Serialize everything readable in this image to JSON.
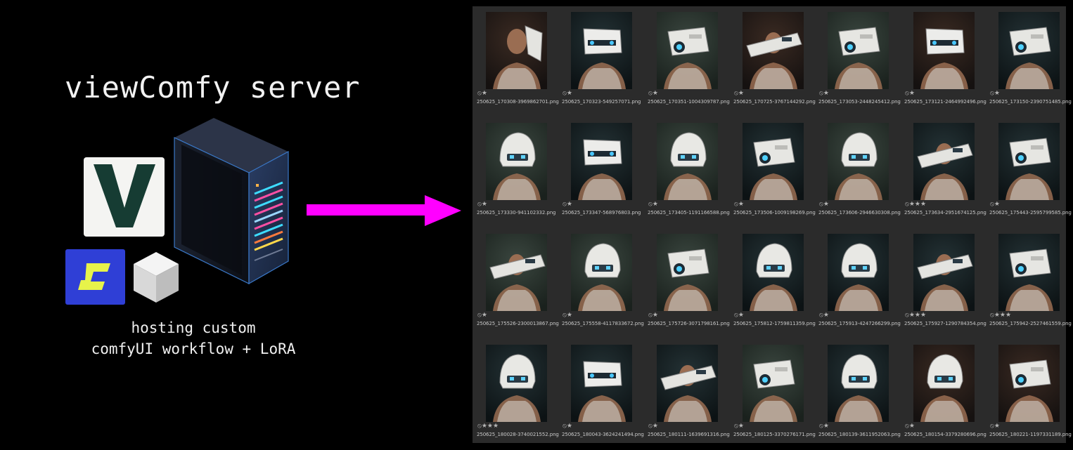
{
  "slide": {
    "title": "viewComfy server",
    "caption_line1": "hosting custom",
    "caption_line2": "comfyUI workflow + LoRA",
    "arrow_color": "#ff00ff",
    "icons": [
      "viewcomfy-logo",
      "comfy-logo",
      "cube-icon",
      "server-rack-icon",
      "arrow-right-icon"
    ]
  },
  "gallery": {
    "background": "#2b2b2b",
    "items": [
      {
        "file": "250625_170308-3969862701.png",
        "rating": "⦸★",
        "tone": "warm",
        "helmet": "side"
      },
      {
        "file": "250625_170323-549257071.png",
        "rating": "⦸★",
        "tone": "dark",
        "helmet": "visor"
      },
      {
        "file": "250625_170351-1004309787.png",
        "rating": "⦸★",
        "tone": "green",
        "helmet": "cam"
      },
      {
        "file": "250625_170725-3767144292.png",
        "rating": "⦸★",
        "tone": "warm",
        "helmet": "gun"
      },
      {
        "file": "250625_173053-2448245412.png",
        "rating": "⦸★",
        "tone": "green",
        "helmet": "cam"
      },
      {
        "file": "250625_173121-2464992496.png",
        "rating": "⦸★",
        "tone": "warm",
        "helmet": "visor"
      },
      {
        "file": "250625_173150-2390751485.png",
        "rating": "⦸★",
        "tone": "dark",
        "helmet": "cam"
      },
      {
        "file": "250625_173330-941102332.png",
        "rating": "⦸★",
        "tone": "green",
        "helmet": "dome"
      },
      {
        "file": "250625_173347-568976803.png",
        "rating": "⦸★",
        "tone": "dark",
        "helmet": "visor"
      },
      {
        "file": "250625_173405-1191166588.png",
        "rating": "⦸★",
        "tone": "green",
        "helmet": "dome"
      },
      {
        "file": "250625_173506-1009198269.png",
        "rating": "⦸★",
        "tone": "dark",
        "helmet": "cam"
      },
      {
        "file": "250625_173606-2946630308.png",
        "rating": "⦸★",
        "tone": "green",
        "helmet": "dome"
      },
      {
        "file": "250625_173634-2951674125.png",
        "rating": "⦸★★★",
        "tone": "dark",
        "helmet": "gun"
      },
      {
        "file": "250625_175443-2595799585.png",
        "rating": "⦸★",
        "tone": "dark",
        "helmet": "cam"
      },
      {
        "file": "250625_175526-2300013867.png",
        "rating": "⦸★",
        "tone": "green",
        "helmet": "gun"
      },
      {
        "file": "250625_175558-4117833672.png",
        "rating": "⦸★",
        "tone": "green",
        "helmet": "dome"
      },
      {
        "file": "250625_175726-3071798161.png",
        "rating": "⦸★",
        "tone": "green",
        "helmet": "cam"
      },
      {
        "file": "250625_175812-1759811359.png",
        "rating": "⦸★",
        "tone": "dark",
        "helmet": "dome"
      },
      {
        "file": "250625_175913-4247266299.png",
        "rating": "⦸★",
        "tone": "dark",
        "helmet": "dome"
      },
      {
        "file": "250625_175927-1290784354.png",
        "rating": "⦸★★★",
        "tone": "dark",
        "helmet": "gun"
      },
      {
        "file": "250625_175942-2527461559.png",
        "rating": "⦸★★★",
        "tone": "dark",
        "helmet": "cam"
      },
      {
        "file": "250625_180028-3740021552.png",
        "rating": "⦸★★★",
        "tone": "dark",
        "helmet": "dome"
      },
      {
        "file": "250625_180043-3624241494.png",
        "rating": "⦸★",
        "tone": "dark",
        "helmet": "visor"
      },
      {
        "file": "250625_180111-1639691316.png",
        "rating": "⦸★",
        "tone": "dark",
        "helmet": "gun"
      },
      {
        "file": "250625_180125-3370276171.png",
        "rating": "⦸★",
        "tone": "green",
        "helmet": "cam"
      },
      {
        "file": "250625_180139-3611952063.png",
        "rating": "⦸★",
        "tone": "dark",
        "helmet": "dome"
      },
      {
        "file": "250625_180154-3379280696.png",
        "rating": "⦸★",
        "tone": "warm",
        "helmet": "dome"
      },
      {
        "file": "250625_180221-1197331189.png",
        "rating": "⦸★",
        "tone": "warm",
        "helmet": "cam"
      }
    ]
  }
}
